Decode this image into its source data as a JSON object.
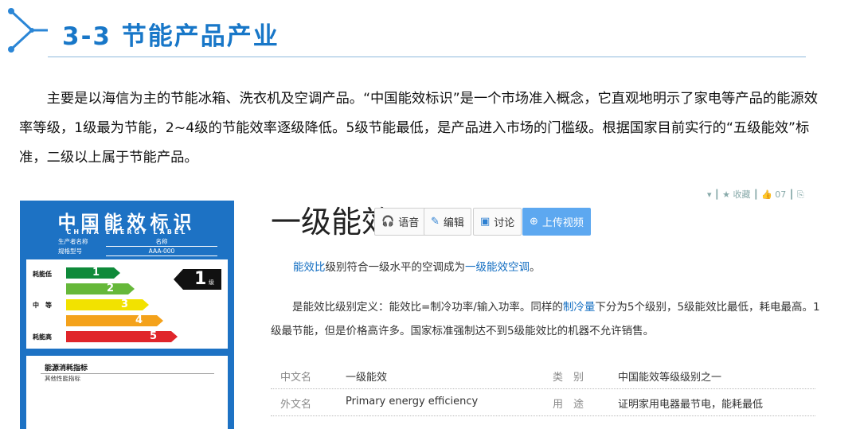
{
  "header": {
    "title": "3-3  节能产品产业"
  },
  "intro": {
    "text": "主要是以海信为主的节能冰箱、洗衣机及空调产品。“中国能效标识”是一个市场准入概念，它直观地明示了家电等产品的能源效率等级，1级最为节能，2~4级的节能效率逐级降低。5级节能最低，是产品进入市场的门槛级。根据国家目前实行的“五级能效”标准，二级以上属于节能产品。"
  },
  "energy_label": {
    "title": "中国能效标识",
    "title_en": "CHINA ENERGY LABEL",
    "manufacturer_key": "生产者名称",
    "manufacturer_value": "名称",
    "model_key": "规格型号",
    "model_value": "AAA-000",
    "side_low": "耗能低",
    "side_mid": "中　等",
    "side_high": "耗能高",
    "grades": [
      "1",
      "2",
      "3",
      "4",
      "5"
    ],
    "grade_colors": [
      "#0f8a3a",
      "#66b83a",
      "#f2e200",
      "#f4a21b",
      "#e0262b"
    ],
    "marker_grade": "1",
    "marker_unit": "级",
    "lower_title": "能源消耗指标",
    "lower_sub": "其他性能指标"
  },
  "entry": {
    "title": "一级能效",
    "buttons": {
      "voice": "语音",
      "edit": "编辑",
      "discuss": "讨论",
      "upload": "上传视频"
    },
    "top_tools": "▾ ┃ ★ 收藏 ┃ 👍 07 ┃ ⎘",
    "summary_link1": "能效比",
    "summary_mid": "级别符合一级水平的空调成为",
    "summary_link2": "一级能效空调",
    "summary_end": "。",
    "def_part1": "是能效比级别定义：能效比=制冷功率/输入功率。同样的",
    "def_link": "制冷量",
    "def_part2": "下分为5个级别，5级能效比最低，耗电最高。1级最节能，但是价格高许多。国家标准强制达不到5级能效比的机器不允许销售。",
    "info": [
      {
        "k1": "中文名",
        "v1": "一级能效",
        "k2": "类　别",
        "v2": "中国能效等级级别之一"
      },
      {
        "k1": "外文名",
        "v1": "Primary energy efficiency",
        "k2": "用　途",
        "v2": "证明家用电器最节电，能耗最低"
      }
    ]
  },
  "colors": {
    "accent": "#1877c8",
    "label_blue": "#1d72c4",
    "link": "#136ec2"
  }
}
